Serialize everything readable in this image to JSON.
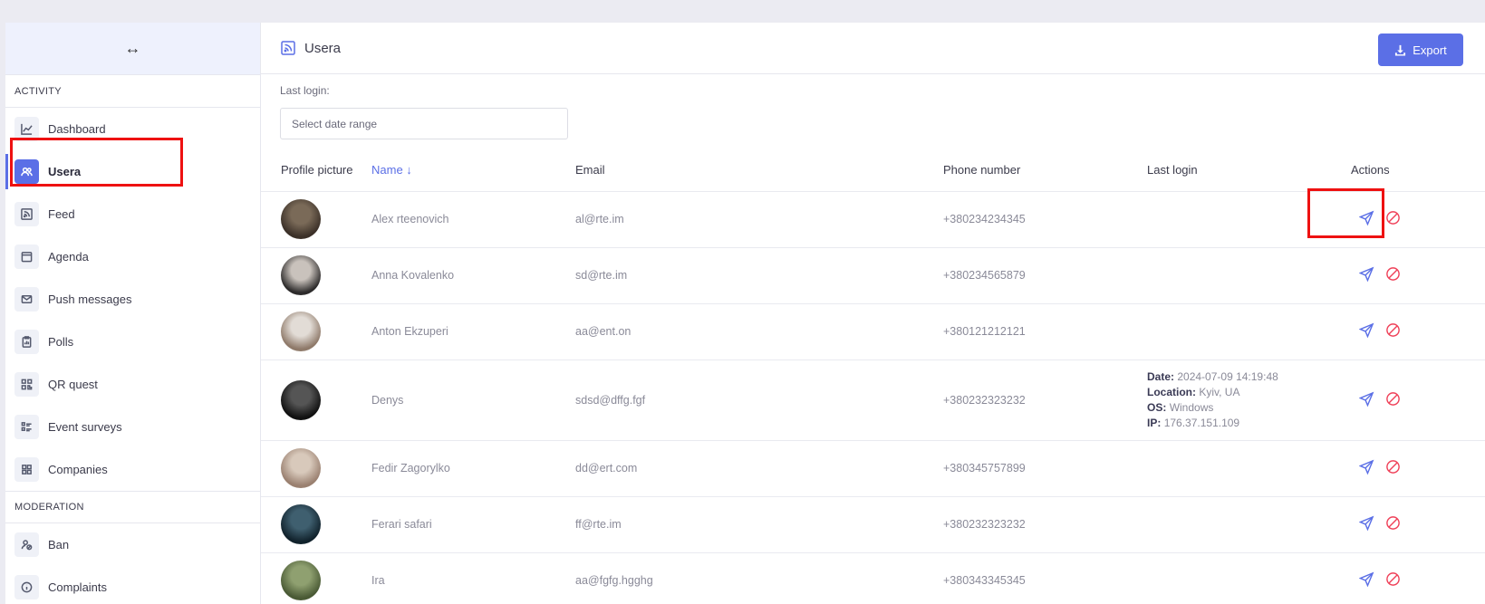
{
  "sidebar": {
    "toggle_icon": "↔",
    "sections": {
      "activity": "ACTIVITY",
      "moderation": "MODERATION"
    },
    "items": [
      {
        "label": "Dashboard",
        "icon": "chart-line-icon"
      },
      {
        "label": "Usera",
        "icon": "users-icon",
        "active": true
      },
      {
        "label": "Feed",
        "icon": "rss-icon"
      },
      {
        "label": "Agenda",
        "icon": "calendar-icon"
      },
      {
        "label": "Push messages",
        "icon": "envelope-icon"
      },
      {
        "label": "Polls",
        "icon": "clipboard-icon"
      },
      {
        "label": "QR quest",
        "icon": "qr-code-icon"
      },
      {
        "label": "Event surveys",
        "icon": "list-icon"
      },
      {
        "label": "Companies",
        "icon": "grid-icon"
      }
    ],
    "moderation_items": [
      {
        "label": "Ban",
        "icon": "user-ban-icon"
      },
      {
        "label": "Complaints",
        "icon": "info-circle-icon"
      }
    ]
  },
  "header": {
    "title": "Usera",
    "export_label": "Export"
  },
  "filter": {
    "label": "Last login:",
    "placeholder": "Select date range"
  },
  "table": {
    "columns": [
      "Profile picture",
      "Name ↓",
      "Email",
      "Phone number",
      "Last login",
      "Actions"
    ],
    "rows": [
      {
        "name": "Alex rteenovich",
        "email": "al@rte.im",
        "phone": "+380234234345",
        "last_login": null
      },
      {
        "name": "Anna Kovalenko",
        "email": "sd@rte.im",
        "phone": "+380234565879",
        "last_login": null
      },
      {
        "name": "Anton Ekzuperi",
        "email": "aa@ent.on",
        "phone": "+380121212121",
        "last_login": null
      },
      {
        "name": "Denys",
        "email": "sdsd@dffg.fgf",
        "phone": "+380232323232",
        "last_login": {
          "date_label": "Date:",
          "date": "2024-07-09 14:19:48",
          "location_label": "Location:",
          "location": "Kyiv, UA",
          "os_label": "OS:",
          "os": "Windows",
          "ip_label": "IP:",
          "ip": "176.37.151.109"
        }
      },
      {
        "name": "Fedir Zagorylko",
        "email": "dd@ert.com",
        "phone": "+380345757899",
        "last_login": null
      },
      {
        "name": "Ferari safari",
        "email": "ff@rte.im",
        "phone": "+380232323232",
        "last_login": null
      },
      {
        "name": "Ira",
        "email": "aa@fgfg.hgghg",
        "phone": "+380343345345",
        "last_login": null
      }
    ]
  },
  "colors": {
    "accent": "#5b6fe6",
    "danger": "#ef4058",
    "highlight": "#ee1111"
  }
}
